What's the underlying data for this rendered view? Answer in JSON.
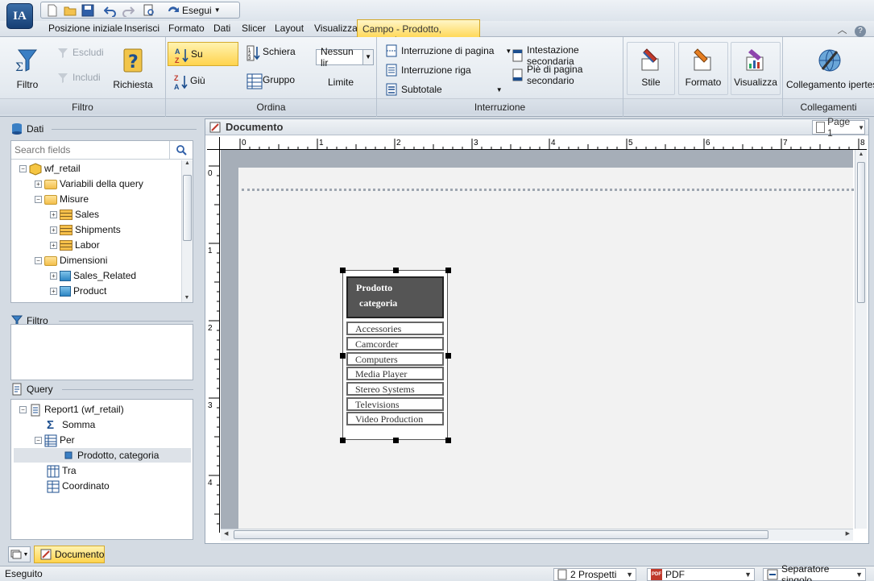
{
  "app": {
    "logo": "IA"
  },
  "qat": {
    "run_label": "Esegui"
  },
  "menu": {
    "tabs": [
      "Posizione iniziale",
      "Inserisci",
      "Formato",
      "Dati",
      "Slicer",
      "Layout",
      "Visualizza"
    ],
    "context_tab": "Campo - Prodotto, categoria"
  },
  "ribbon": {
    "filtro": {
      "label": "Filtro",
      "button": "Filtro",
      "escludi": "Escludi",
      "includi": "Includi",
      "richiesta": "Richiesta"
    },
    "ordina": {
      "label": "Ordina",
      "su": "Su",
      "giu": "Giù",
      "schiera": "Schiera",
      "gruppo": "Gruppo",
      "limit_value": "Nessun lir",
      "limite": "Limite"
    },
    "interruzione": {
      "label": "Interruzione",
      "pagina": "Interruzione di pagina",
      "riga": "Interruzione riga",
      "subtotale": "Subtotale",
      "intestazione": "Intestazione secondaria",
      "piede": "Piè di pagina secondario"
    },
    "stile": "Stile",
    "formato": "Formato",
    "visualizza": "Visualizza",
    "collegamenti": {
      "label": "Collegamenti",
      "button": "Collegamento ipertes"
    }
  },
  "dati_panel": {
    "title": "Dati",
    "search_placeholder": "Search fields",
    "tree": [
      {
        "label": "wf_retail"
      },
      {
        "label": "Variabili della query"
      },
      {
        "label": "Misure"
      },
      {
        "label": "Sales"
      },
      {
        "label": "Shipments"
      },
      {
        "label": "Labor"
      },
      {
        "label": "Dimensioni"
      },
      {
        "label": "Sales_Related"
      },
      {
        "label": "Product"
      }
    ]
  },
  "filtro_panel": {
    "title": "Filtro"
  },
  "query_panel": {
    "title": "Query",
    "tree": [
      {
        "label": "Report1 (wf_retail)"
      },
      {
        "label": "Somma"
      },
      {
        "label": "Per"
      },
      {
        "label": "Prodotto, categoria"
      },
      {
        "label": "Tra"
      },
      {
        "label": "Coordinato"
      }
    ]
  },
  "document": {
    "title": "Documento",
    "page_selector": "Page 1",
    "ruler_h": [
      "0",
      "1",
      "2",
      "3",
      "4",
      "5",
      "6",
      "7",
      "8"
    ],
    "ruler_v": [
      "0",
      "1",
      "2",
      "3",
      "4"
    ],
    "table": {
      "header_line1": "Prodotto",
      "header_line2": "categoria",
      "rows": [
        "Accessories",
        "Camcorder",
        "Computers",
        "Media Player",
        "Stereo Systems",
        "Televisions",
        "Video Production"
      ]
    }
  },
  "bottom_tab": {
    "label": "Documento"
  },
  "status": {
    "text": "Eseguito",
    "prospetti": "2 Prospetti",
    "format": "PDF",
    "separator": "Separatore singolo"
  },
  "colors": {
    "context_tab": "#ffd95a",
    "header_cell": "#555555",
    "accent": "#2d86c3"
  }
}
